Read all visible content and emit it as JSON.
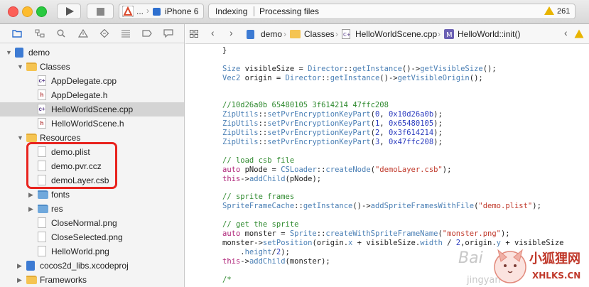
{
  "toolbar": {
    "scheme_ellipsis": "...",
    "scheme_destination": "iPhone 6",
    "status_left": "Indexing",
    "status_right": "Processing files",
    "warning_count": "261"
  },
  "jump_bar": {
    "items": [
      "demo",
      "Classes",
      "HelloWorldScene.cpp",
      "HelloWorld::init()"
    ]
  },
  "navigator": {
    "rows": [
      {
        "label": "demo",
        "kind": "project",
        "indent": 0,
        "disclosure": "▼"
      },
      {
        "label": "Classes",
        "kind": "folder",
        "indent": 1,
        "disclosure": "▼"
      },
      {
        "label": "AppDelegate.cpp",
        "kind": "cpp",
        "indent": 2,
        "disclosure": ""
      },
      {
        "label": "AppDelegate.h",
        "kind": "h",
        "indent": 2,
        "disclosure": ""
      },
      {
        "label": "HelloWorldScene.cpp",
        "kind": "cpp",
        "indent": 2,
        "disclosure": "",
        "selected": true
      },
      {
        "label": "HelloWorldScene.h",
        "kind": "h",
        "indent": 2,
        "disclosure": ""
      },
      {
        "label": "Resources",
        "kind": "folder",
        "indent": 1,
        "disclosure": "▼"
      },
      {
        "label": "demo.plist",
        "kind": "doc",
        "indent": 2,
        "disclosure": ""
      },
      {
        "label": "demo.pvr.ccz",
        "kind": "doc",
        "indent": 2,
        "disclosure": ""
      },
      {
        "label": "demoLayer.csb",
        "kind": "doc",
        "indent": 2,
        "disclosure": ""
      },
      {
        "label": "fonts",
        "kind": "folder-blue",
        "indent": 2,
        "disclosure": "▶"
      },
      {
        "label": "res",
        "kind": "folder-blue",
        "indent": 2,
        "disclosure": "▶"
      },
      {
        "label": "CloseNormal.png",
        "kind": "doc",
        "indent": 2,
        "disclosure": ""
      },
      {
        "label": "CloseSelected.png",
        "kind": "doc",
        "indent": 2,
        "disclosure": ""
      },
      {
        "label": "HelloWorld.png",
        "kind": "doc",
        "indent": 2,
        "disclosure": ""
      },
      {
        "label": "cocos2d_libs.xcodeproj",
        "kind": "project",
        "indent": 1,
        "disclosure": "▶"
      },
      {
        "label": "Frameworks",
        "kind": "folder",
        "indent": 1,
        "disclosure": "▶"
      }
    ]
  },
  "code_lines": [
    [
      {
        "t": "}",
        "c": "pl"
      }
    ],
    [],
    [
      {
        "t": "Size ",
        "c": ""
      },
      {
        "t": "visibleSize = ",
        "c": "pl"
      },
      {
        "t": "Director",
        "c": ""
      },
      {
        "t": "::",
        "c": "pl"
      },
      {
        "t": "getInstance",
        "c": ""
      },
      {
        "t": "()->",
        "c": "pl"
      },
      {
        "t": "getVisibleSize",
        "c": ""
      },
      {
        "t": "();",
        "c": "pl"
      }
    ],
    [
      {
        "t": "Vec2 ",
        "c": ""
      },
      {
        "t": "origin = ",
        "c": "pl"
      },
      {
        "t": "Director",
        "c": ""
      },
      {
        "t": "::",
        "c": "pl"
      },
      {
        "t": "getInstance",
        "c": ""
      },
      {
        "t": "()->",
        "c": "pl"
      },
      {
        "t": "getVisibleOrigin",
        "c": ""
      },
      {
        "t": "();",
        "c": "pl"
      }
    ],
    [],
    [],
    [
      {
        "t": "//10d26a0b 65480105 3f614214 47ffc208",
        "c": "cm"
      }
    ],
    [
      {
        "t": "ZipUtils",
        "c": ""
      },
      {
        "t": "::",
        "c": "pl"
      },
      {
        "t": "setPvrEncryptionKeyPart",
        "c": ""
      },
      {
        "t": "(",
        "c": "pl"
      },
      {
        "t": "0",
        "c": "nm"
      },
      {
        "t": ", ",
        "c": "pl"
      },
      {
        "t": "0x10d26a0b",
        "c": "nm"
      },
      {
        "t": ");",
        "c": "pl"
      }
    ],
    [
      {
        "t": "ZipUtils",
        "c": ""
      },
      {
        "t": "::",
        "c": "pl"
      },
      {
        "t": "setPvrEncryptionKeyPart",
        "c": ""
      },
      {
        "t": "(",
        "c": "pl"
      },
      {
        "t": "1",
        "c": "nm"
      },
      {
        "t": ", ",
        "c": "pl"
      },
      {
        "t": "0x65480105",
        "c": "nm"
      },
      {
        "t": ");",
        "c": "pl"
      }
    ],
    [
      {
        "t": "ZipUtils",
        "c": ""
      },
      {
        "t": "::",
        "c": "pl"
      },
      {
        "t": "setPvrEncryptionKeyPart",
        "c": ""
      },
      {
        "t": "(",
        "c": "pl"
      },
      {
        "t": "2",
        "c": "nm"
      },
      {
        "t": ", ",
        "c": "pl"
      },
      {
        "t": "0x3f614214",
        "c": "nm"
      },
      {
        "t": ");",
        "c": "pl"
      }
    ],
    [
      {
        "t": "ZipUtils",
        "c": ""
      },
      {
        "t": "::",
        "c": "pl"
      },
      {
        "t": "setPvrEncryptionKeyPart",
        "c": ""
      },
      {
        "t": "(",
        "c": "pl"
      },
      {
        "t": "3",
        "c": "nm"
      },
      {
        "t": ", ",
        "c": "pl"
      },
      {
        "t": "0x47ffc208",
        "c": "nm"
      },
      {
        "t": ");",
        "c": "pl"
      }
    ],
    [],
    [
      {
        "t": "// load csb file",
        "c": "cm"
      }
    ],
    [
      {
        "t": "auto ",
        "c": "kw"
      },
      {
        "t": "pNode = ",
        "c": "pl"
      },
      {
        "t": "CSLoader",
        "c": ""
      },
      {
        "t": "::",
        "c": "pl"
      },
      {
        "t": "createNode",
        "c": ""
      },
      {
        "t": "(",
        "c": "pl"
      },
      {
        "t": "\"demoLayer.csb\"",
        "c": "st"
      },
      {
        "t": ");",
        "c": "pl"
      }
    ],
    [
      {
        "t": "this",
        "c": "kw"
      },
      {
        "t": "->",
        "c": "pl"
      },
      {
        "t": "addChild",
        "c": ""
      },
      {
        "t": "(pNode);",
        "c": "pl"
      }
    ],
    [],
    [
      {
        "t": "// sprite frames",
        "c": "cm"
      }
    ],
    [
      {
        "t": "SpriteFrameCache",
        "c": ""
      },
      {
        "t": "::",
        "c": "pl"
      },
      {
        "t": "getInstance",
        "c": ""
      },
      {
        "t": "()->",
        "c": "pl"
      },
      {
        "t": "addSpriteFramesWithFile",
        "c": ""
      },
      {
        "t": "(",
        "c": "pl"
      },
      {
        "t": "\"demo.plist\"",
        "c": "st"
      },
      {
        "t": ");",
        "c": "pl"
      }
    ],
    [],
    [
      {
        "t": "// get the sprite",
        "c": "cm"
      }
    ],
    [
      {
        "t": "auto ",
        "c": "kw"
      },
      {
        "t": "monster = ",
        "c": "pl"
      },
      {
        "t": "Sprite",
        "c": ""
      },
      {
        "t": "::",
        "c": "pl"
      },
      {
        "t": "createWithSpriteFrameName",
        "c": ""
      },
      {
        "t": "(",
        "c": "pl"
      },
      {
        "t": "\"monster.png\"",
        "c": "st"
      },
      {
        "t": ");",
        "c": "pl"
      }
    ],
    [
      {
        "t": "monster->",
        "c": "pl"
      },
      {
        "t": "setPosition",
        "c": ""
      },
      {
        "t": "(origin.",
        "c": "pl"
      },
      {
        "t": "x",
        "c": ""
      },
      {
        "t": " + visibleSize.",
        "c": "pl"
      },
      {
        "t": "width",
        "c": ""
      },
      {
        "t": " / ",
        "c": "pl"
      },
      {
        "t": "2",
        "c": "nm"
      },
      {
        "t": ",origin.",
        "c": "pl"
      },
      {
        "t": "y",
        "c": ""
      },
      {
        "t": " + visibleSize",
        "c": "pl"
      }
    ],
    [
      {
        "t": "    .",
        "c": "pl"
      },
      {
        "t": "height",
        "c": ""
      },
      {
        "t": "/",
        "c": "pl"
      },
      {
        "t": "2",
        "c": "nm"
      },
      {
        "t": ");",
        "c": "pl"
      }
    ],
    [
      {
        "t": "this",
        "c": "kw"
      },
      {
        "t": "->",
        "c": "pl"
      },
      {
        "t": "addChild",
        "c": ""
      },
      {
        "t": "(monster);",
        "c": "pl"
      }
    ],
    [],
    [
      {
        "t": "/*",
        "c": "cm"
      }
    ]
  ],
  "watermark": {
    "text_main": "小狐狸网",
    "text_url": "XHLKS.CN",
    "text_baidu": "Bai",
    "text_jy": "jingyan"
  },
  "icons": {
    "navigator": [
      "folder-nav-icon",
      "hierarchy-icon",
      "search-icon",
      "warning-nav-icon",
      "test-icon",
      "debug-icon",
      "breakpoint-icon",
      "report-icon"
    ]
  }
}
